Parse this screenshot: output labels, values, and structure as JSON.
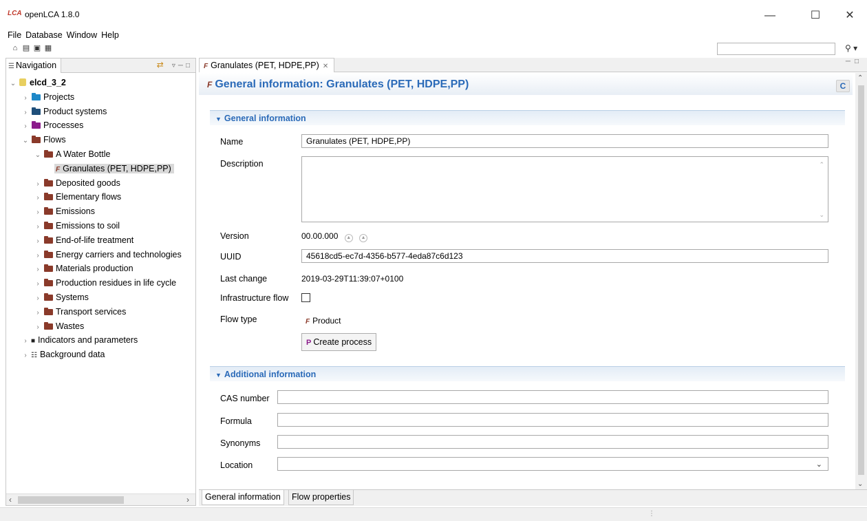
{
  "window": {
    "title": "openLCA 1.8.0",
    "logo_text": "LCA"
  },
  "menu": [
    "File",
    "Database",
    "Window",
    "Help"
  ],
  "search": {
    "value": ""
  },
  "navigation": {
    "tab_label": "Navigation",
    "tree": [
      {
        "label": "elcd_3_2",
        "level": 0,
        "expanded": true,
        "kind": "db"
      },
      {
        "label": "Projects",
        "level": 1,
        "kind": "folder-blue"
      },
      {
        "label": "Product systems",
        "level": 1,
        "kind": "folder-navy"
      },
      {
        "label": "Processes",
        "level": 1,
        "kind": "folder-purple"
      },
      {
        "label": "Flows",
        "level": 1,
        "expanded": true,
        "kind": "folder-brown"
      },
      {
        "label": "A Water Bottle",
        "level": 2,
        "expanded": true,
        "kind": "folder-brown"
      },
      {
        "label": "Granulates (PET, HDPE,PP)",
        "level": 3,
        "kind": "flow",
        "selected": true
      },
      {
        "label": "Deposited goods",
        "level": 2,
        "kind": "folder-brown"
      },
      {
        "label": "Elementary flows",
        "level": 2,
        "kind": "folder-brown"
      },
      {
        "label": "Emissions",
        "level": 2,
        "kind": "folder-brown"
      },
      {
        "label": "Emissions to soil",
        "level": 2,
        "kind": "folder-brown"
      },
      {
        "label": "End-of-life treatment",
        "level": 2,
        "kind": "folder-brown"
      },
      {
        "label": "Energy carriers and technologies",
        "level": 2,
        "kind": "folder-brown"
      },
      {
        "label": "Materials production",
        "level": 2,
        "kind": "folder-brown"
      },
      {
        "label": "Production residues in life cycle",
        "level": 2,
        "kind": "folder-brown"
      },
      {
        "label": "Systems",
        "level": 2,
        "kind": "folder-brown"
      },
      {
        "label": "Transport services",
        "level": 2,
        "kind": "folder-brown"
      },
      {
        "label": "Wastes",
        "level": 2,
        "kind": "folder-brown"
      },
      {
        "label": "Indicators and parameters",
        "level": 1,
        "kind": "indicators"
      },
      {
        "label": "Background data",
        "level": 1,
        "kind": "background"
      }
    ]
  },
  "editor": {
    "tab_label": "Granulates (PET, HDPE,PP)",
    "header_title": "General information: Granulates (PET, HDPE,PP)",
    "general_section": {
      "title": "General information",
      "name_label": "Name",
      "name_value": "Granulates (PET, HDPE,PP)",
      "description_label": "Description",
      "description_value": "",
      "version_label": "Version",
      "version_value": "00.00.000",
      "uuid_label": "UUID",
      "uuid_value": "45618cd5-ec7d-4356-b577-4eda87c6d123",
      "last_change_label": "Last change",
      "last_change_value": "2019-03-29T11:39:07+0100",
      "infrastructure_label": "Infrastructure flow",
      "infrastructure_checked": false,
      "flow_type_label": "Flow type",
      "flow_type_value": "Product",
      "create_process_label": "Create process"
    },
    "additional_section": {
      "title": "Additional information",
      "cas_label": "CAS number",
      "cas_value": "",
      "formula_label": "Formula",
      "formula_value": "",
      "synonyms_label": "Synonyms",
      "synonyms_value": "",
      "location_label": "Location",
      "location_value": ""
    },
    "bottom_tabs": [
      "General information",
      "Flow properties"
    ]
  }
}
